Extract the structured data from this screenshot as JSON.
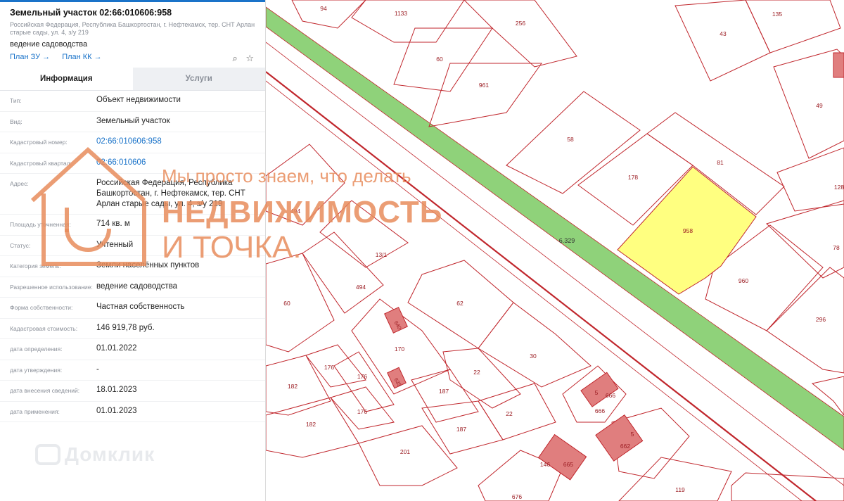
{
  "panel": {
    "title": "Земельный участок 02:66:010606:958",
    "address": "Российская Федерация, Республика Башкортостан, г. Нефтекамск, тер. СНТ Арлан старые сады, ул. 4, з/у 219",
    "usage": "ведение садоводства",
    "link_plan_zu": "План ЗУ →",
    "link_plan_kk": "План КК →",
    "icons": [
      "search-doc-icon",
      "star-icon"
    ],
    "tabs": [
      {
        "label": "Информация",
        "active": true
      },
      {
        "label": "Услуги",
        "active": false
      }
    ],
    "rows": [
      {
        "label": "Тип:",
        "value": "Объект недвижимости"
      },
      {
        "label": "Вид:",
        "value": "Земельный участок"
      },
      {
        "label": "Кадастровый номер:",
        "value": "02:66:010606:958",
        "link": true
      },
      {
        "label": "Кадастровый квартал:",
        "value": "02:66:010606",
        "link": true
      },
      {
        "label": "Адрес:",
        "value": "Российская Федерация, Республика Башкортостан, г. Нефтекамск, тер. СНТ Арлан старые сады, ул. 4, з/у 219"
      },
      {
        "label": "Площадь уточненная:",
        "value": "714 кв. м"
      },
      {
        "label": "Статус:",
        "value": "Учтенный"
      },
      {
        "label": "Категория земель:",
        "value": "Земли населённых пунктов"
      },
      {
        "label": "Разрешенное использование:",
        "value": "ведение садоводства"
      },
      {
        "label": "Форма собственности:",
        "value": "Частная собственность"
      },
      {
        "label": "Кадастровая стоимость:",
        "value": "146 919,78 руб."
      },
      {
        "label": "дата определения:",
        "value": "01.01.2022"
      },
      {
        "label": "дата утверждения:",
        "value": "-"
      },
      {
        "label": "дата внесения сведений:",
        "value": "18.01.2023"
      },
      {
        "label": "дата применения:",
        "value": "01.01.2023"
      }
    ]
  },
  "brand": "Домклик",
  "watermark": {
    "line1": "Мы просто знаем, что делать",
    "line2": "НЕДВИЖИМОСТЬ",
    "line3": "И ТОЧКА."
  },
  "map": {
    "road_label": "6.329",
    "highlight_color": "#ffff80",
    "road_color": "#8fd27a",
    "parcel_stroke": "#c0262c",
    "parcel_labels": [
      "94",
      "1133",
      "256",
      "135",
      "43",
      "60",
      "961",
      "49",
      "58",
      "81",
      "178",
      "128",
      "958",
      "494",
      "13/1",
      "78",
      "960",
      "494",
      "60",
      "62",
      "296",
      "640",
      "170",
      "30",
      "176",
      "182",
      "176",
      "22",
      "639",
      "187",
      "5",
      "666",
      "666",
      "176",
      "182",
      "187",
      "22",
      "5",
      "662",
      "201",
      "146",
      "665",
      "676",
      "119"
    ]
  }
}
